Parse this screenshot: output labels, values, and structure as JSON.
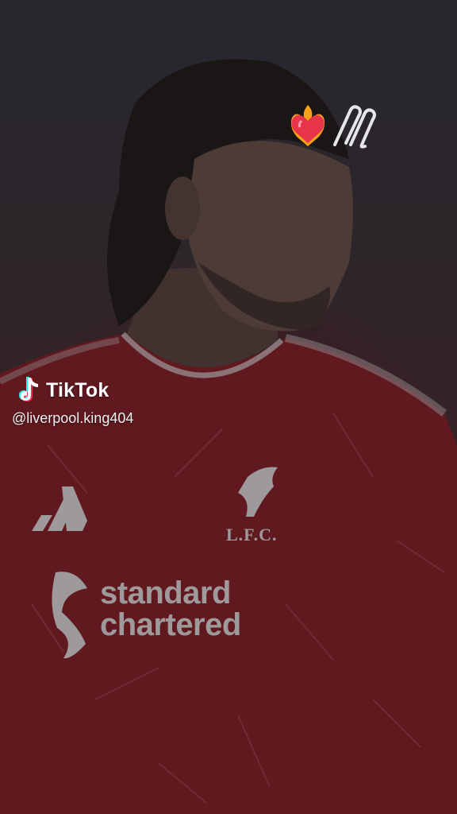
{
  "video": {
    "watermark": {
      "brand": "TikTok",
      "handle": "@liverpool.king404"
    },
    "emoji_overlay": [
      "heart-on-fire-emoji",
      "paperclips-emoji"
    ],
    "jersey": {
      "sponsor_line1": "standard",
      "sponsor_line2": "chartered",
      "club_initials": "L.F.C."
    },
    "colors": {
      "jersey_red": "#8a1c26",
      "overlay_dark": "#2b2b31",
      "tiktok_cyan": "#25f4ee",
      "tiktok_pink": "#fe2c55"
    }
  }
}
